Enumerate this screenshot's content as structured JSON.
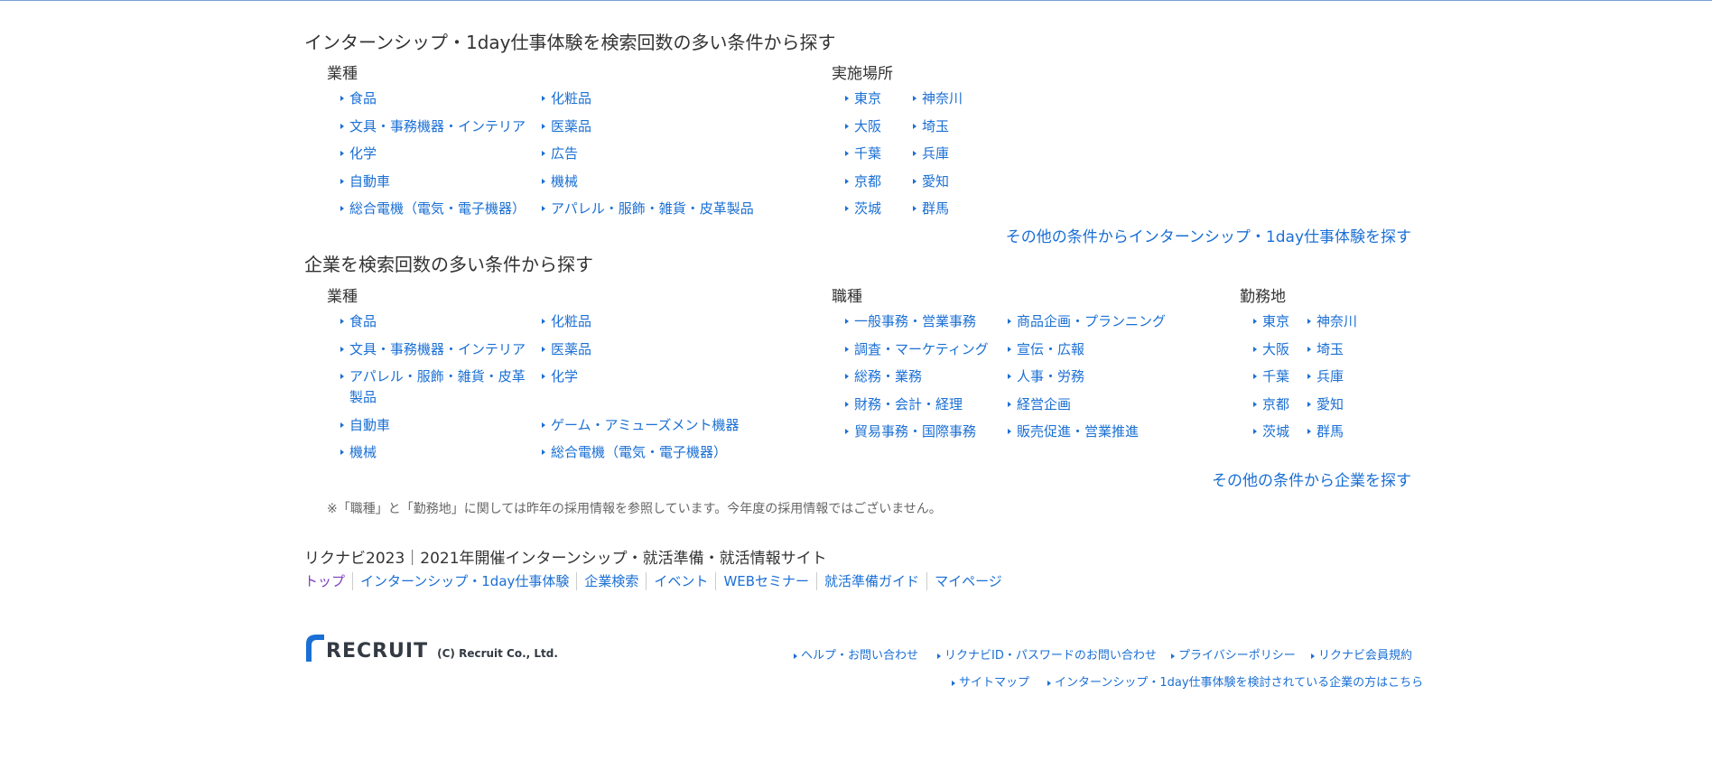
{
  "section1": {
    "title": "インターンシップ・1day仕事体験を検索回数の多い条件から探す",
    "industry_heading": "業種",
    "industry": [
      "食品",
      "化粧品",
      "文具・事務機器・インテリア",
      "医薬品",
      "化学",
      "広告",
      "自動車",
      "機械",
      "総合電機（電気・電子機器）",
      "アパレル・服飾・雑貨・皮革製品"
    ],
    "location_heading": "実施場所",
    "location": [
      "東京",
      "神奈川",
      "大阪",
      "埼玉",
      "千葉",
      "兵庫",
      "京都",
      "愛知",
      "茨城",
      "群馬"
    ],
    "more": "その他の条件からインターンシップ・1day仕事体験を探す"
  },
  "section2": {
    "title": "企業を検索回数の多い条件から探す",
    "industry_heading": "業種",
    "industry": [
      "食品",
      "化粧品",
      "文具・事務機器・インテリア",
      "医薬品",
      "アパレル・服飾・雑貨・皮革製品",
      "化学",
      "自動車",
      "ゲーム・アミューズメント機器",
      "機械",
      "総合電機（電気・電子機器）"
    ],
    "job_heading": "職種",
    "job": [
      "一般事務・営業事務",
      "商品企画・プランニング",
      "調査・マーケティング",
      "宣伝・広報",
      "総務・業務",
      "人事・労務",
      "財務・会計・経理",
      "経営企画",
      "貿易事務・国際事務",
      "販売促進・営業推進"
    ],
    "workplace_heading": "勤務地",
    "workplace": [
      "東京",
      "神奈川",
      "大阪",
      "埼玉",
      "千葉",
      "兵庫",
      "京都",
      "愛知",
      "茨城",
      "群馬"
    ],
    "more": "その他の条件から企業を探す",
    "note": "※「職種」と「勤務地」に関しては昨年の採用情報を参照しています。今年度の採用情報ではございません。"
  },
  "site": {
    "title": "リクナビ2023｜2021年開催インターンシップ・就活準備・就活情報サイト",
    "nav": [
      "トップ",
      "インターンシップ・1day仕事体験",
      "企業検索",
      "イベント",
      "WEBセミナー",
      "就活準備ガイド",
      "マイページ"
    ]
  },
  "footer": {
    "logo_text": "RECRUIT",
    "copyright": "(C) Recruit Co., Ltd.",
    "links_row1": [
      "ヘルプ・お問い合わせ",
      "リクナビID・パスワードのお問い合わせ",
      "プライバシーポリシー",
      "リクナビ会員規約"
    ],
    "links_row2": [
      "サイトマップ",
      "インターンシップ・1day仕事体験を検討されている企業の方はこちら"
    ]
  },
  "colors": {
    "link": "#1a6fd4",
    "text": "#333333",
    "visited": "#7a3fc0"
  }
}
